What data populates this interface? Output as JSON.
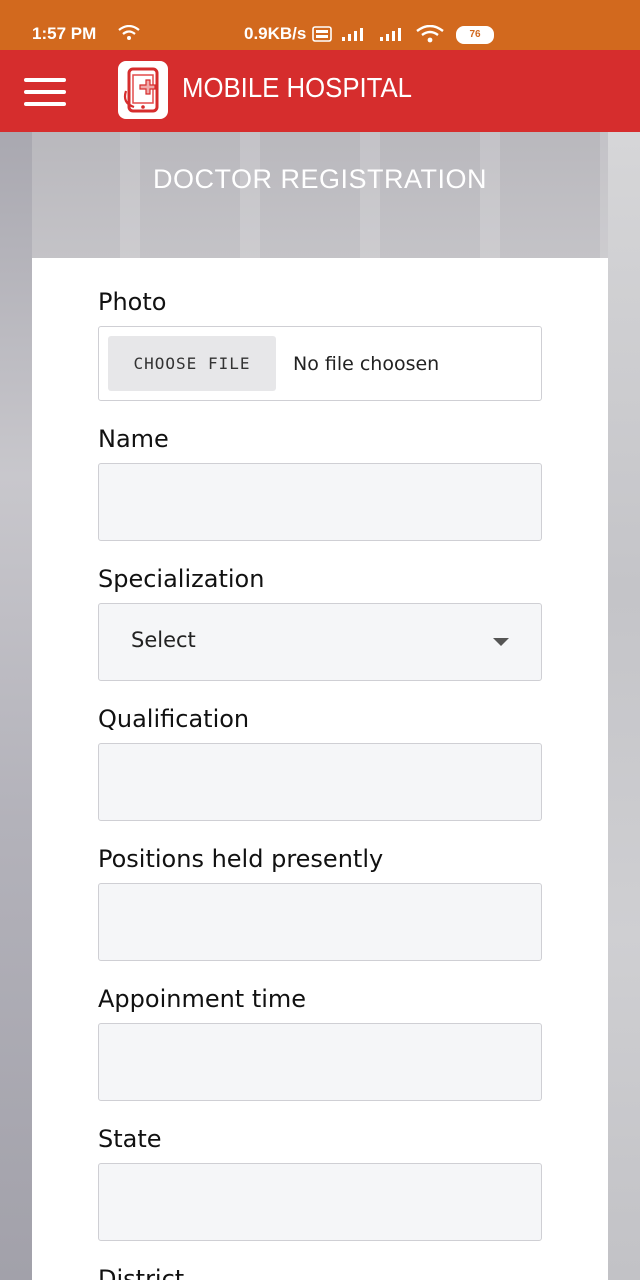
{
  "status_bar": {
    "time": "1:57 PM",
    "speed": "0.9KB/s",
    "battery": "76",
    "icons": [
      "wifi-icon",
      "volte-icon",
      "signal-icon",
      "signal-icon",
      "wifi-icon"
    ]
  },
  "app_bar": {
    "title": "MOBILE HOSPITAL",
    "menu_icon": "hamburger-menu-icon",
    "logo": "mobile-hospital-logo"
  },
  "page": {
    "heading": "DOCTOR REGISTRATION"
  },
  "form": {
    "photo": {
      "label": "Photo",
      "button_label": "CHOOSE FILE",
      "status": "No file choosen"
    },
    "name": {
      "label": "Name",
      "value": ""
    },
    "specialization": {
      "label": "Specialization",
      "selected": "Select"
    },
    "qualification": {
      "label": "Qualification",
      "value": ""
    },
    "positions": {
      "label": "Positions held presently",
      "value": ""
    },
    "appointment": {
      "label": "Appoinment time",
      "value": ""
    },
    "state": {
      "label": "State",
      "value": ""
    },
    "district": {
      "label": "District"
    }
  },
  "colors": {
    "status_bar": "#d2691e",
    "app_bar": "#d62d2d",
    "card": "#ffffff",
    "input_bg": "#f5f6f8"
  }
}
